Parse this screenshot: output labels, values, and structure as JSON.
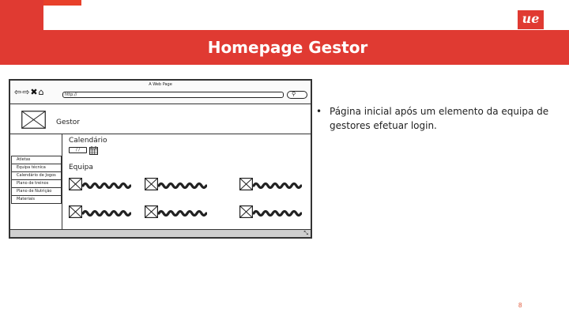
{
  "slide": {
    "title": "Homepage Gestor",
    "logo_text": "ue",
    "page_number": "8",
    "accent_color": "#e03a32",
    "bullet": "Página inicial após um elemento da equipa de gestores efetuar login."
  },
  "wireframe": {
    "window_title": "A Web Page",
    "nav_icons": [
      "back-arrow-icon",
      "forward-arrow-icon",
      "close-x-icon",
      "home-icon"
    ],
    "nav_glyphs": "⇦⇨✖⌂",
    "url": "http://",
    "app_name": "Gestor",
    "sidebar_items": [
      "Atletas",
      "Equipa técnica",
      "Calendário de Jogos",
      "Plano de treinos",
      "Plano de Nutrição",
      "Materiais"
    ],
    "calendar_heading": "Calendário",
    "date_value": "/ /",
    "team_heading": "Equipa",
    "team_member_count": 6
  }
}
